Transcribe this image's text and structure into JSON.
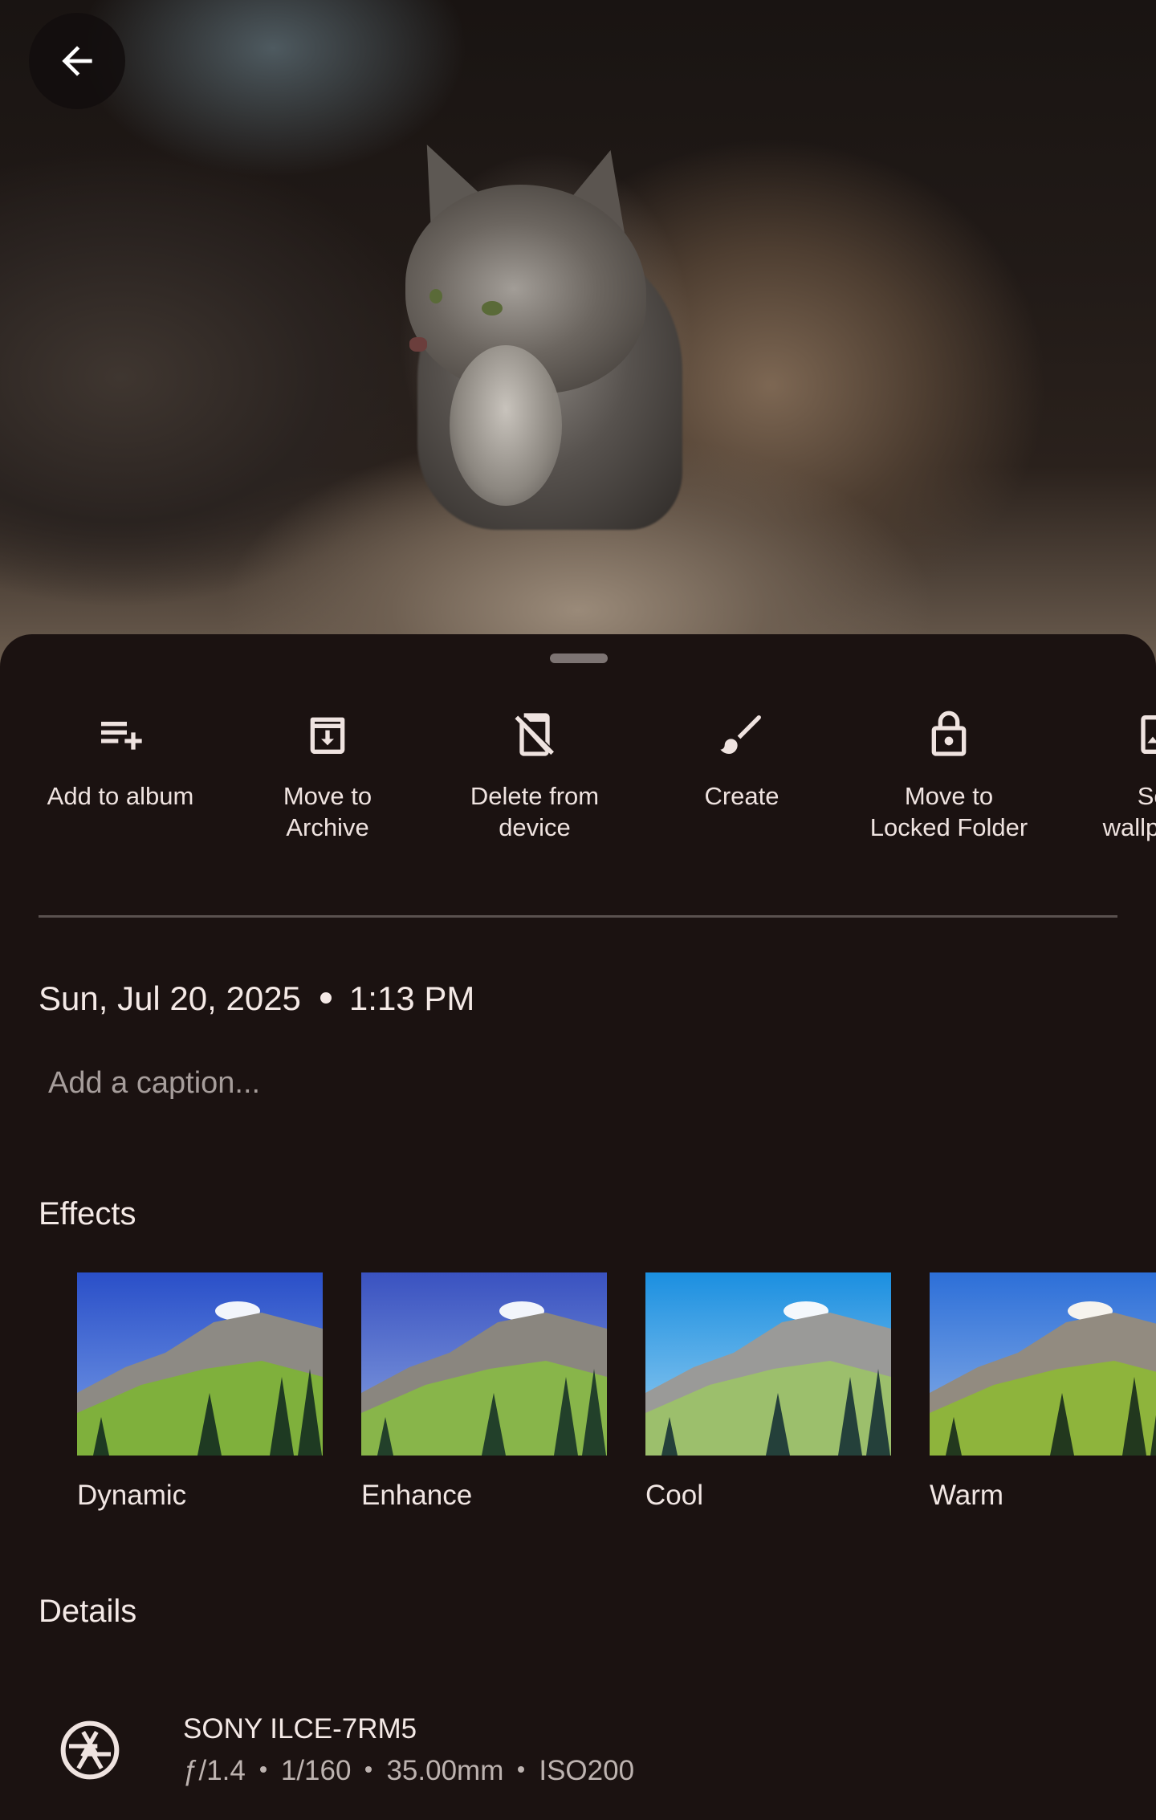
{
  "header": {
    "back_icon": "arrow-back-icon"
  },
  "photo": {
    "subject": ""
  },
  "actions": [
    {
      "label": "Add to album",
      "icon": "playlist-add-icon"
    },
    {
      "label": "Move to\nArchive",
      "icon": "archive-icon"
    },
    {
      "label": "Delete from\ndevice",
      "icon": "phone-off-icon"
    },
    {
      "label": "Create",
      "icon": "brush-icon"
    },
    {
      "label": "Move to\nLocked Folder",
      "icon": "lock-icon"
    },
    {
      "label": "Set\nwallpaper",
      "icon": "wallpaper-icon"
    }
  ],
  "info": {
    "date": "Sun, Jul 20, 2025",
    "time": "1:13 PM",
    "caption_placeholder": "Add a caption..."
  },
  "effects": {
    "title": "Effects",
    "items": [
      {
        "label": "Dynamic"
      },
      {
        "label": "Enhance"
      },
      {
        "label": "Cool"
      },
      {
        "label": "Warm"
      }
    ]
  },
  "details": {
    "title": "Details",
    "camera": "SONY ILCE-7RM5",
    "aperture": "ƒ/1.4",
    "shutter": "1/160",
    "focal_length": "35.00mm",
    "iso": "ISO200",
    "icon": "aperture-icon"
  },
  "colors": {
    "background": "#1b1211",
    "text": "#f1e6e3",
    "muted": "#a69d9b"
  }
}
